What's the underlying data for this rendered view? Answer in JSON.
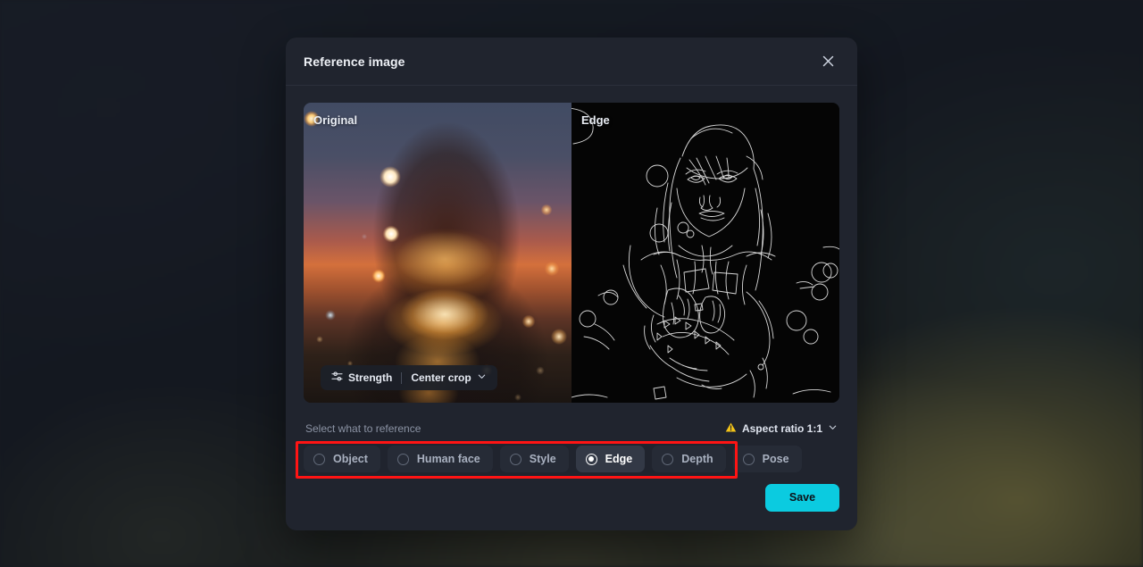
{
  "dialog": {
    "title": "Reference image",
    "close_icon": "close-icon"
  },
  "preview": {
    "panes": [
      {
        "label": "Original",
        "kind": "photo",
        "description": "Woman holding glowing string lights at sunset over a city skyline"
      },
      {
        "label": "Edge",
        "kind": "edge-map",
        "description": "White Canny edge outlines on black background"
      }
    ],
    "toolbar": {
      "strength_label": "Strength",
      "strength_icon": "sliders-icon",
      "crop_label": "Center crop",
      "crop_chevron_icon": "chevron-down-icon"
    }
  },
  "options": {
    "label": "Select what to reference",
    "aspect_ratio": {
      "warning_icon": "warning-triangle-icon",
      "label": "Aspect ratio 1:1",
      "chevron_icon": "chevron-down-icon"
    },
    "items": [
      {
        "label": "Object",
        "selected": false
      },
      {
        "label": "Human face",
        "selected": false
      },
      {
        "label": "Style",
        "selected": false
      },
      {
        "label": "Edge",
        "selected": true
      },
      {
        "label": "Depth",
        "selected": false
      },
      {
        "label": "Pose",
        "selected": false
      }
    ]
  },
  "footer": {
    "save_label": "Save"
  },
  "colors": {
    "accent": "#0bcbe0",
    "annotation": "#ff1414",
    "warning": "#f5c518",
    "dialog_bg": "#20242e",
    "chip_bg": "#262b36",
    "chip_selected_bg": "#333946"
  }
}
